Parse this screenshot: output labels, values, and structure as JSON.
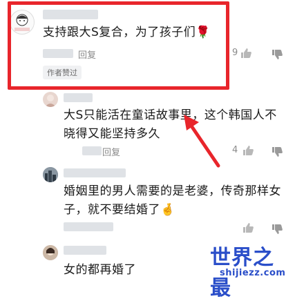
{
  "comments": [
    {
      "text": "支持跟大S复合，为了孩子们🌹",
      "reply_label": "回复",
      "likes": "9",
      "badge": "作者赞过",
      "avatar_icon": "cartoon-avatar-icon"
    },
    {
      "text": "大S只能活在童话故事里，这个韩国人不晓得又能坚持多久",
      "reply_label": "回复",
      "likes": "4",
      "avatar_icon": "user-avatar-icon"
    },
    {
      "text": "婚姻里的男人需要的是老婆，传奇那样女子，就不要结婚了🤞",
      "avatar_icon": "city-avatar-icon"
    },
    {
      "text": "女的都再婚了",
      "avatar_icon": "user-avatar-icon"
    }
  ],
  "watermark": {
    "title": "世界之最",
    "url": "shijiezz.com"
  },
  "colors": {
    "highlight_frame": "#e8252b",
    "arrow": "#e8252b",
    "watermark": "#2a4ec9"
  }
}
